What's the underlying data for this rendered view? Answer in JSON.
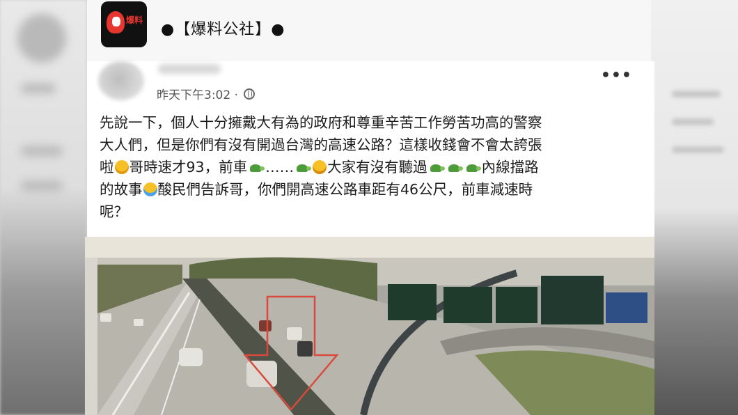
{
  "page": {
    "logo_text": "爆料",
    "name": "●【爆料公社】●"
  },
  "post": {
    "timestamp": "昨天下午3:02 ·",
    "more_label": "•••",
    "body": {
      "line1": "先說一下，個人十分擁戴大有為的政府和尊重辛苦工作勞苦功高的警察",
      "line2": "大人們，但是你們有沒有開過台灣的高速公路？這樣收錢會不會太誇張",
      "line3_a": "啦",
      "line3_b": "哥時速才93，前車",
      "line3_c": "……",
      "line3_d": "大家有沒有聽過",
      "line3_e": "內線擋路",
      "line4_a": "的故事",
      "line4_b": "酸民們告訴哥，你們開高速公路車距有46公尺，前車減速時",
      "line5": "呢？"
    },
    "emoji_icons": [
      "grinning-sweat-face-icon",
      "turtle-icon",
      "crying-face-icon",
      "laughing-tears-face-icon"
    ]
  },
  "colors": {
    "logo_red": "#e7352f",
    "sign_green": "#1e3b2c",
    "sign_blue": "#2d4f86"
  }
}
